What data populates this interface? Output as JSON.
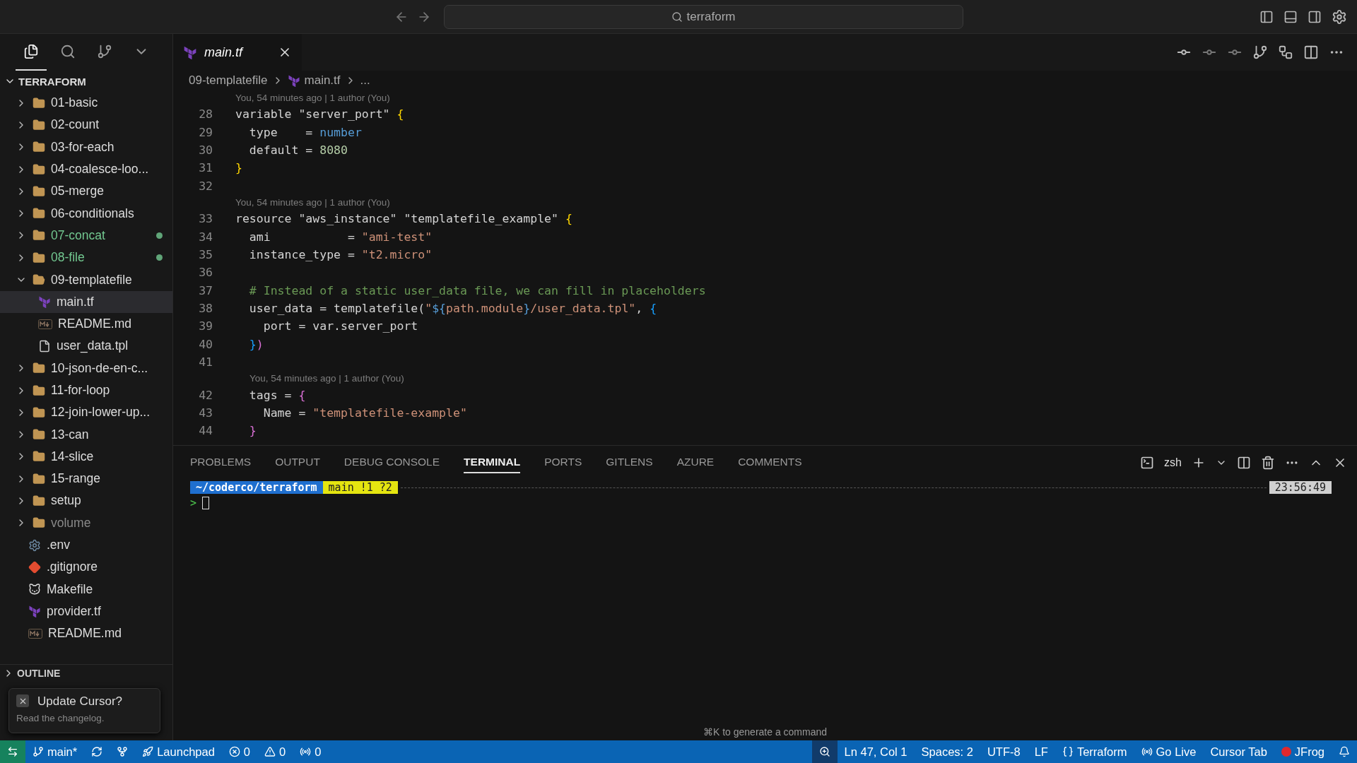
{
  "title_bar": {
    "search": "terraform"
  },
  "activity": [
    {
      "kind": "files",
      "selected": true
    },
    {
      "kind": "search",
      "selected": false
    },
    {
      "kind": "git",
      "selected": false
    },
    {
      "kind": "more",
      "selected": false
    }
  ],
  "explorer": {
    "title": "TERRAFORM",
    "items": [
      {
        "label": "01-basic",
        "kind": "folder",
        "expanded": false,
        "changed": false,
        "ignored": false,
        "selected": false
      },
      {
        "label": "02-count",
        "kind": "folder",
        "expanded": false,
        "changed": false,
        "ignored": false,
        "selected": false
      },
      {
        "label": "03-for-each",
        "kind": "folder",
        "expanded": false,
        "changed": false,
        "ignored": false,
        "selected": false
      },
      {
        "label": "04-coalesce-loo...",
        "kind": "folder",
        "expanded": false,
        "changed": false,
        "ignored": false,
        "selected": false
      },
      {
        "label": "05-merge",
        "kind": "folder",
        "expanded": false,
        "changed": false,
        "ignored": false,
        "selected": false
      },
      {
        "label": "06-conditionals",
        "kind": "folder",
        "expanded": false,
        "changed": false,
        "ignored": false,
        "selected": false
      },
      {
        "label": "07-concat",
        "kind": "folder",
        "expanded": false,
        "changed": true,
        "ignored": false,
        "selected": false
      },
      {
        "label": "08-file",
        "kind": "folder",
        "expanded": false,
        "changed": true,
        "ignored": false,
        "selected": false
      },
      {
        "label": "09-templatefile",
        "kind": "folder",
        "expanded": true,
        "changed": false,
        "ignored": false,
        "selected": false,
        "children": [
          {
            "label": "main.tf",
            "kind": "terraform",
            "changed": false,
            "ignored": false,
            "selected": true
          },
          {
            "label": "README.md",
            "kind": "markdown",
            "changed": false,
            "ignored": false,
            "selected": false
          },
          {
            "label": "user_data.tpl",
            "kind": "text",
            "changed": false,
            "ignored": false,
            "selected": false
          }
        ]
      },
      {
        "label": "10-json-de-en-c...",
        "kind": "folder",
        "expanded": false,
        "changed": false,
        "ignored": false,
        "selected": false
      },
      {
        "label": "11-for-loop",
        "kind": "folder",
        "expanded": false,
        "changed": false,
        "ignored": false,
        "selected": false
      },
      {
        "label": "12-join-lower-up...",
        "kind": "folder",
        "expanded": false,
        "changed": false,
        "ignored": false,
        "selected": false
      },
      {
        "label": "13-can",
        "kind": "folder",
        "expanded": false,
        "changed": false,
        "ignored": false,
        "selected": false
      },
      {
        "label": "14-slice",
        "kind": "folder",
        "expanded": false,
        "changed": false,
        "ignored": false,
        "selected": false
      },
      {
        "label": "15-range",
        "kind": "folder",
        "expanded": false,
        "changed": false,
        "ignored": false,
        "selected": false
      },
      {
        "label": "setup",
        "kind": "folder",
        "expanded": false,
        "changed": false,
        "ignored": false,
        "selected": false
      },
      {
        "label": "volume",
        "kind": "folder",
        "expanded": false,
        "changed": false,
        "ignored": true,
        "selected": false
      },
      {
        "label": ".env",
        "kind": "gear",
        "changed": false,
        "ignored": false,
        "selected": false
      },
      {
        "label": ".gitignore",
        "kind": "git",
        "changed": false,
        "ignored": false,
        "selected": false
      },
      {
        "label": "Makefile",
        "kind": "makefile",
        "changed": false,
        "ignored": false,
        "selected": false
      },
      {
        "label": "provider.tf",
        "kind": "terraform",
        "changed": false,
        "ignored": false,
        "selected": false
      },
      {
        "label": "README.md",
        "kind": "markdown",
        "changed": false,
        "ignored": false,
        "selected": false
      }
    ]
  },
  "sections": [
    {
      "label": "OUTLINE",
      "expanded": false
    }
  ],
  "notification": {
    "title": "Update Cursor?",
    "body": "Read the changelog."
  },
  "tabs": [
    {
      "label": "main.tf",
      "selected": true
    }
  ],
  "breadcrumb": {
    "folder": "09-templatefile",
    "file": "main.tf",
    "rest": "..."
  },
  "code": [
    {
      "kind": "blame",
      "text": "You, 54 minutes ago | 1 author (You)",
      "nested": false
    },
    {
      "kind": "line",
      "number": "28",
      "tokens": [
        {
          "t": "variable \"server_port\" ",
          "kind": "plain"
        },
        {
          "t": "{",
          "kind": "brace1"
        }
      ]
    },
    {
      "kind": "line",
      "number": "29",
      "tokens": [
        {
          "t": "  type    = ",
          "kind": "plain"
        },
        {
          "t": "number",
          "kind": "type"
        }
      ]
    },
    {
      "kind": "line",
      "number": "30",
      "tokens": [
        {
          "t": "  default = ",
          "kind": "plain"
        },
        {
          "t": "8080",
          "kind": "num"
        }
      ]
    },
    {
      "kind": "line",
      "number": "31",
      "tokens": [
        {
          "t": "}",
          "kind": "brace1"
        }
      ]
    },
    {
      "kind": "line",
      "number": "32"
    },
    {
      "kind": "blame",
      "text": "You, 54 minutes ago | 1 author (You)",
      "nested": false
    },
    {
      "kind": "line",
      "number": "33",
      "tokens": [
        {
          "t": "resource \"aws_instance\" \"templatefile_example\" ",
          "kind": "plain"
        },
        {
          "t": "{",
          "kind": "brace1"
        }
      ]
    },
    {
      "kind": "line",
      "number": "34",
      "tokens": [
        {
          "t": "  ami           = ",
          "kind": "plain"
        },
        {
          "t": "\"ami-test\"",
          "kind": "str"
        }
      ]
    },
    {
      "kind": "line",
      "number": "35",
      "tokens": [
        {
          "t": "  instance_type = ",
          "kind": "plain"
        },
        {
          "t": "\"t2.micro\"",
          "kind": "str"
        }
      ]
    },
    {
      "kind": "line",
      "number": "36"
    },
    {
      "kind": "line",
      "number": "37",
      "tokens": [
        {
          "t": "  # Instead of a static user_data file, we can fill in placeholders",
          "kind": "comment"
        }
      ]
    },
    {
      "kind": "line",
      "number": "38",
      "tokens": [
        {
          "t": "  user_data = templatefile(",
          "kind": "plain"
        },
        {
          "t": "\"",
          "kind": "str"
        },
        {
          "t": "${",
          "kind": "interp"
        },
        {
          "t": "path.module",
          "kind": "str"
        },
        {
          "t": "}",
          "kind": "interp"
        },
        {
          "t": "/user_data.tpl\"",
          "kind": "str"
        },
        {
          "t": ", ",
          "kind": "plain"
        },
        {
          "t": "{",
          "kind": "brace3"
        }
      ]
    },
    {
      "kind": "line",
      "number": "39",
      "tokens": [
        {
          "t": "    port = var.server_port",
          "kind": "plain"
        }
      ]
    },
    {
      "kind": "line",
      "number": "40",
      "tokens": [
        {
          "t": "  }",
          "kind": "brace3"
        },
        {
          "t": ")",
          "kind": "brace2"
        }
      ]
    },
    {
      "kind": "line",
      "number": "41"
    },
    {
      "kind": "blame",
      "text": "You, 54 minutes ago | 1 author (You)",
      "nested": true
    },
    {
      "kind": "line",
      "number": "42",
      "tokens": [
        {
          "t": "  tags = ",
          "kind": "plain"
        },
        {
          "t": "{",
          "kind": "brace2"
        }
      ]
    },
    {
      "kind": "line",
      "number": "43",
      "tokens": [
        {
          "t": "    Name = ",
          "kind": "plain"
        },
        {
          "t": "\"templatefile-example\"",
          "kind": "str"
        }
      ]
    },
    {
      "kind": "line",
      "number": "44",
      "tokens": [
        {
          "t": "  }",
          "kind": "brace2"
        }
      ]
    }
  ],
  "panel": {
    "tabs": [
      {
        "label": "PROBLEMS",
        "selected": false
      },
      {
        "label": "OUTPUT",
        "selected": false
      },
      {
        "label": "DEBUG CONSOLE",
        "selected": false
      },
      {
        "label": "TERMINAL",
        "selected": true
      },
      {
        "label": "PORTS",
        "selected": false
      },
      {
        "label": "GITLENS",
        "selected": false
      },
      {
        "label": "AZURE",
        "selected": false
      },
      {
        "label": "COMMENTS",
        "selected": false
      }
    ],
    "shell": "zsh",
    "terminal": {
      "path": "~/coderco/terraform",
      "branch": "main !1 ?2",
      "time": "23:56:49",
      "prompt": ">"
    },
    "hint": "⌘K to generate a command"
  },
  "status_bar": {
    "left": [
      {
        "kind": "branch",
        "text": "main*"
      },
      {
        "kind": "sync"
      },
      {
        "kind": "graph"
      },
      {
        "kind": "launchpad",
        "text": "Launchpad"
      },
      {
        "kind": "errors",
        "text": "0"
      },
      {
        "kind": "warnings",
        "text": "0"
      },
      {
        "kind": "ports",
        "text": "0"
      }
    ],
    "right": [
      {
        "kind": "zoom"
      },
      {
        "kind": "plain",
        "text": "Ln 47, Col 1"
      },
      {
        "kind": "plain",
        "text": "Spaces: 2"
      },
      {
        "kind": "plain",
        "text": "UTF-8"
      },
      {
        "kind": "plain",
        "text": "LF"
      },
      {
        "kind": "language",
        "text": "Terraform"
      },
      {
        "kind": "live",
        "text": "Go Live"
      },
      {
        "kind": "plain",
        "text": "Cursor Tab"
      },
      {
        "kind": "jfrog",
        "text": "JFrog"
      },
      {
        "kind": "bell"
      }
    ]
  }
}
